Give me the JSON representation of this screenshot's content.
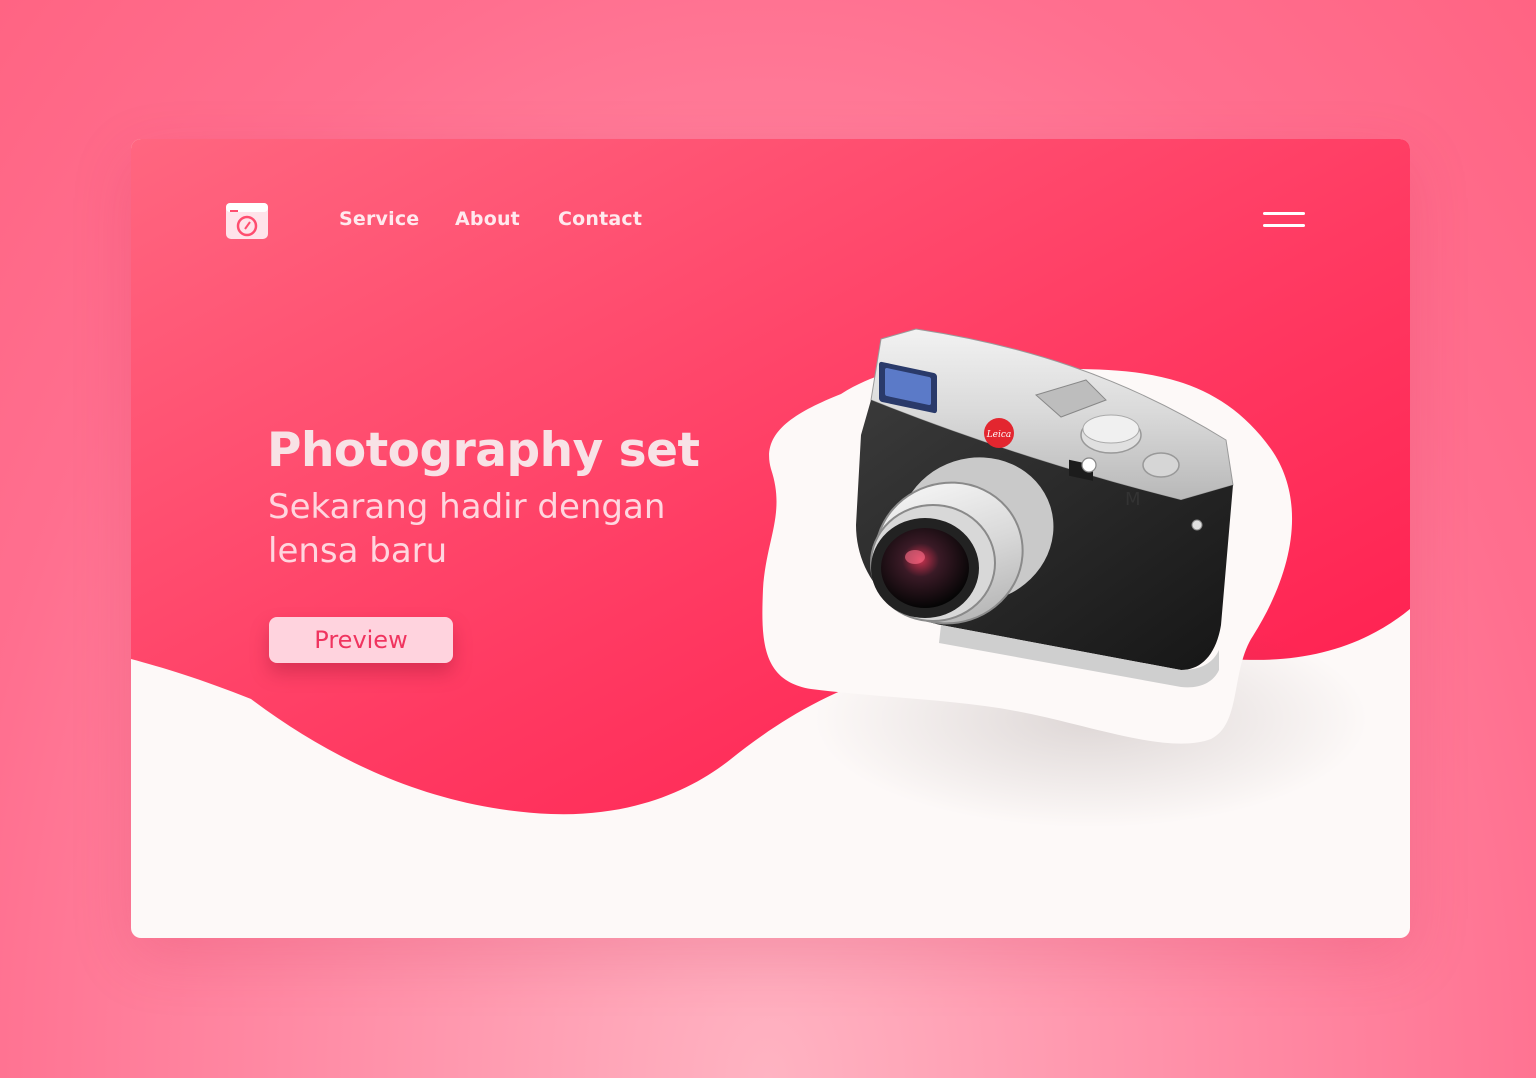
{
  "header": {
    "logo_icon": "camera-logo-icon",
    "nav": [
      {
        "label": "Service"
      },
      {
        "label": "About"
      },
      {
        "label": "Contact"
      }
    ],
    "menu_icon": "hamburger-menu-icon"
  },
  "hero": {
    "title": "Photography set",
    "subtitle": "Sekarang hadir dengan lensa baru",
    "cta_label": "Preview",
    "product_image": "camera-photo"
  },
  "colors": {
    "accent": "#ff2a56",
    "accent_light": "#ff5f7c",
    "button_bg": "#ffd3de",
    "button_text": "#f0345f",
    "page_bg": "#ff7a95",
    "card_bottom": "#fdf9f8"
  }
}
